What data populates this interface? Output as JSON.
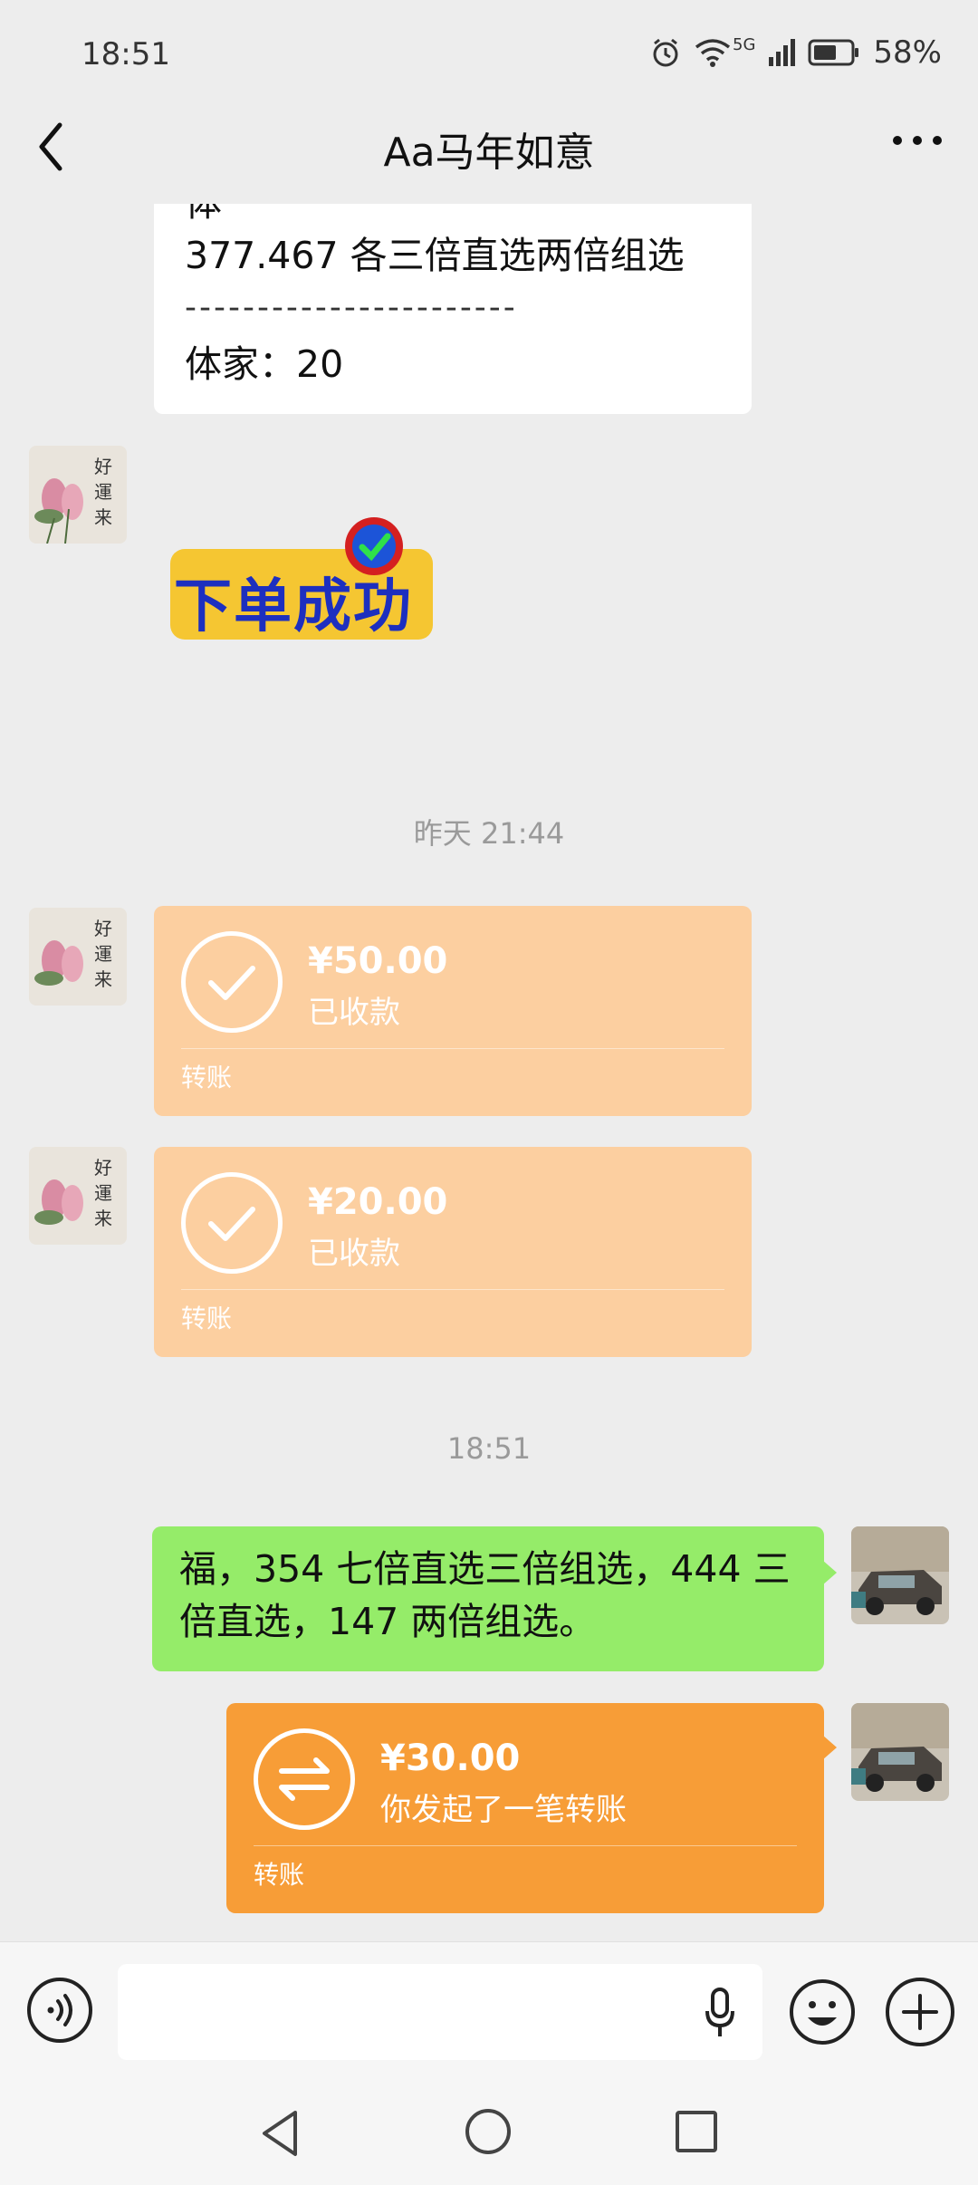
{
  "status_bar": {
    "time": "18:51",
    "network": "5G",
    "battery": "58%"
  },
  "header": {
    "title": "Aa马年如意"
  },
  "messages": {
    "top_text": {
      "partial_line": "体",
      "line1": "377.467 各三倍直选两倍组选",
      "dashes": "-----------------------",
      "line3": "体家：20"
    },
    "sticker_text": "下单成功",
    "timestamp1": "昨天 21:44",
    "transfer1": {
      "amount": "¥50.00",
      "status": "已收款",
      "kind": "转账"
    },
    "transfer2": {
      "amount": "¥20.00",
      "status": "已收款",
      "kind": "转账"
    },
    "timestamp2": "18:51",
    "sent_text": "福，354 七倍直选三倍组选，444 三倍直选，147 两倍组选。",
    "transfer3": {
      "amount": "¥30.00",
      "status": "你发起了一笔转账",
      "kind": "转账"
    }
  },
  "input": {
    "value": "",
    "placeholder": ""
  },
  "colors": {
    "received_transfer": "#fccfa0",
    "sent_transfer": "#f79d37",
    "sent_bubble": "#95ec69",
    "background": "#ededed"
  },
  "icons": {
    "back": "chevron-left-icon",
    "more": "more-dots-icon",
    "voice": "voice-icon",
    "mic": "mic-icon",
    "emoji": "emoji-icon",
    "plus": "plus-icon"
  }
}
